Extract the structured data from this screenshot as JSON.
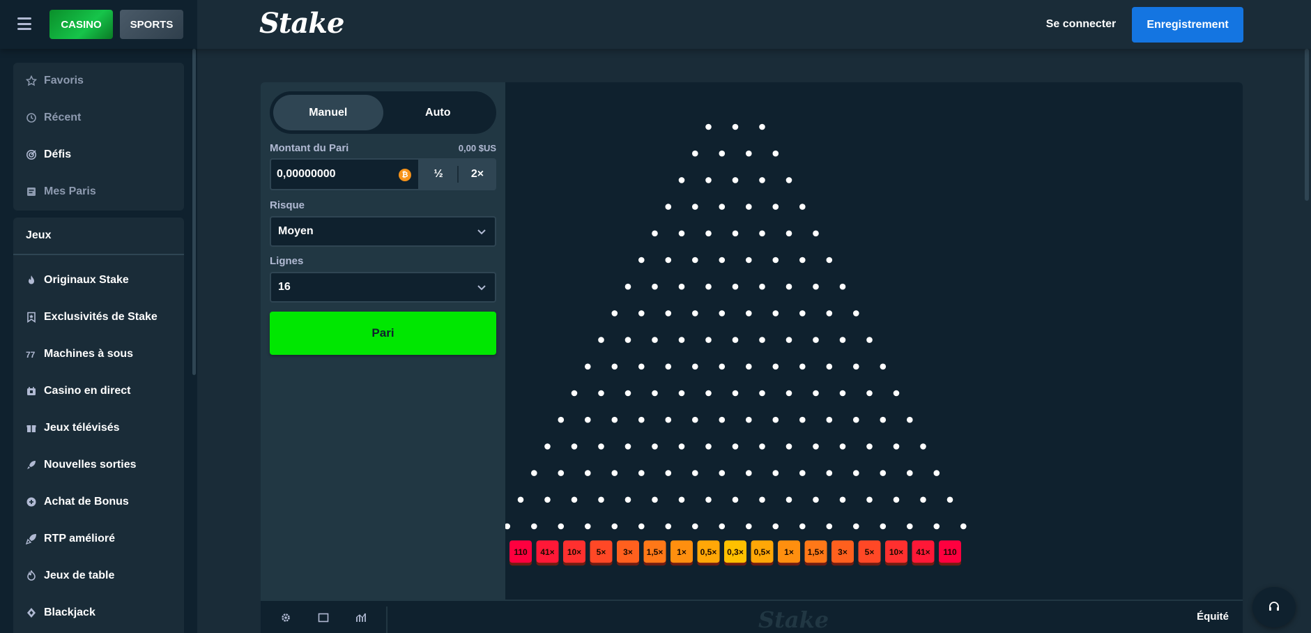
{
  "header": {
    "casino_tab": "CASINO",
    "sports_tab": "SPORTS",
    "logo": "Stake",
    "login": "Se connecter",
    "register": "Enregistrement"
  },
  "sidebar": {
    "top_items": [
      {
        "label": "Favoris",
        "icon": "star-icon"
      },
      {
        "label": "Récent",
        "icon": "history-icon"
      },
      {
        "label": "Défis",
        "icon": "challenge-icon"
      },
      {
        "label": "Mes Paris",
        "icon": "bets-icon"
      }
    ],
    "games_header": "Jeux",
    "game_items": [
      {
        "label": "Originaux Stake",
        "icon": "flame-icon"
      },
      {
        "label": "Exclusivités de Stake",
        "icon": "bookmark-star-icon"
      },
      {
        "label": "Machines à sous",
        "icon": "slots-icon"
      },
      {
        "label": "Casino en direct",
        "icon": "live-casino-icon"
      },
      {
        "label": "Jeux télévisés",
        "icon": "gift-icon"
      },
      {
        "label": "Nouvelles sorties",
        "icon": "rocket-icon"
      },
      {
        "label": "Achat de Bonus",
        "icon": "bonus-icon"
      },
      {
        "label": "RTP amélioré",
        "icon": "rocket-boost-icon"
      },
      {
        "label": "Jeux de table",
        "icon": "fire-icon"
      },
      {
        "label": "Blackjack",
        "icon": "blackjack-icon"
      }
    ]
  },
  "game": {
    "mode_manual": "Manuel",
    "mode_auto": "Auto",
    "bet_label": "Montant du Pari",
    "bet_value_usd": "0,00 $US",
    "bet_amount": "0,00000000",
    "currency_icon": "bitcoin-icon",
    "half": "½",
    "double": "2×",
    "risk_label": "Risque",
    "risk_value": "Moyen",
    "rows_label": "Lignes",
    "rows_value": "16",
    "bet_button": "Pari",
    "fairness": "Équité",
    "footer_logo": "Stake",
    "multipliers": [
      "110",
      "41×",
      "10×",
      "5×",
      "3×",
      "1,5×",
      "1×",
      "0,5×",
      "0,3×",
      "0,5×",
      "1×",
      "1,5×",
      "3×",
      "5×",
      "10×",
      "41×",
      "110"
    ],
    "multiplier_colors": [
      "#ff003f",
      "#ff1837",
      "#ff302f",
      "#ff4826",
      "#ff601e",
      "#ff7818",
      "#ff8f0f",
      "#ffa707",
      "#ffc000",
      "#ffa707",
      "#ff8f0f",
      "#ff7818",
      "#ff601e",
      "#ff4826",
      "#ff302f",
      "#ff1837",
      "#ff003f"
    ],
    "peg_rows": 16,
    "accent_green": "#00e701",
    "accent_blue": "#1475e1"
  }
}
